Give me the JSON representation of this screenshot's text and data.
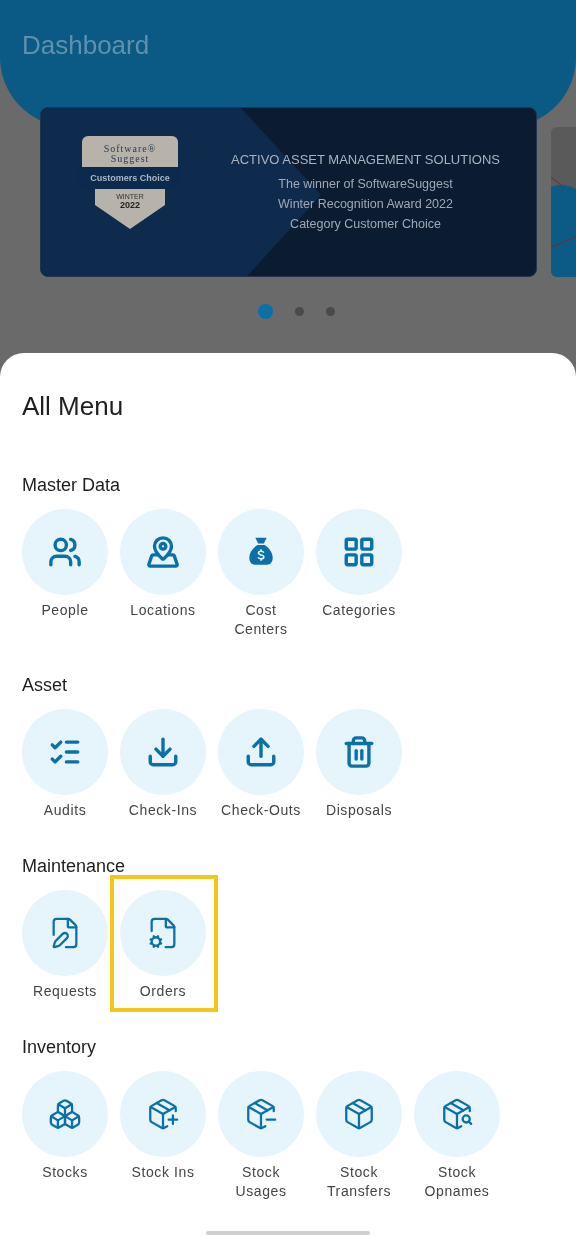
{
  "header": {
    "title": "Dashboard"
  },
  "banner": {
    "badge": {
      "brand_top": "Software®",
      "brand_bottom": "Suggest",
      "ribbon": "Customers Choice",
      "season": "WINTER",
      "year": "2022"
    },
    "headline": "ACTIVO ASSET MANAGEMENT SOLUTIONS",
    "lines": [
      "The winner of SoftwareSuggest",
      "Winter Recognition Award 2022",
      "Category Customer Choice"
    ]
  },
  "carousel_dots": [
    {
      "selected": true
    },
    {
      "selected": false
    },
    {
      "selected": false
    }
  ],
  "sheet": {
    "title": "All Menu",
    "sections": [
      {
        "title": "Master Data",
        "items": [
          {
            "label": "People",
            "highlighted": false
          },
          {
            "label": "Locations",
            "highlighted": false
          },
          {
            "label": "Cost Centers",
            "highlighted": false
          },
          {
            "label": "Categories",
            "highlighted": false
          }
        ]
      },
      {
        "title": "Asset",
        "items": [
          {
            "label": "Audits",
            "highlighted": false
          },
          {
            "label": "Check-Ins",
            "highlighted": false
          },
          {
            "label": "Check-Outs",
            "highlighted": false
          },
          {
            "label": "Disposals",
            "highlighted": false
          }
        ]
      },
      {
        "title": "Maintenance",
        "items": [
          {
            "label": "Requests",
            "highlighted": false
          },
          {
            "label": "Orders",
            "highlighted": true
          }
        ]
      },
      {
        "title": "Inventory",
        "items": [
          {
            "label": "Stocks",
            "highlighted": false
          },
          {
            "label": "Stock Ins",
            "highlighted": false
          },
          {
            "label": "Stock Usages",
            "highlighted": false
          },
          {
            "label": "Stock Transfers",
            "highlighted": false
          },
          {
            "label": "Stock Opnames",
            "highlighted": false
          }
        ]
      }
    ]
  }
}
